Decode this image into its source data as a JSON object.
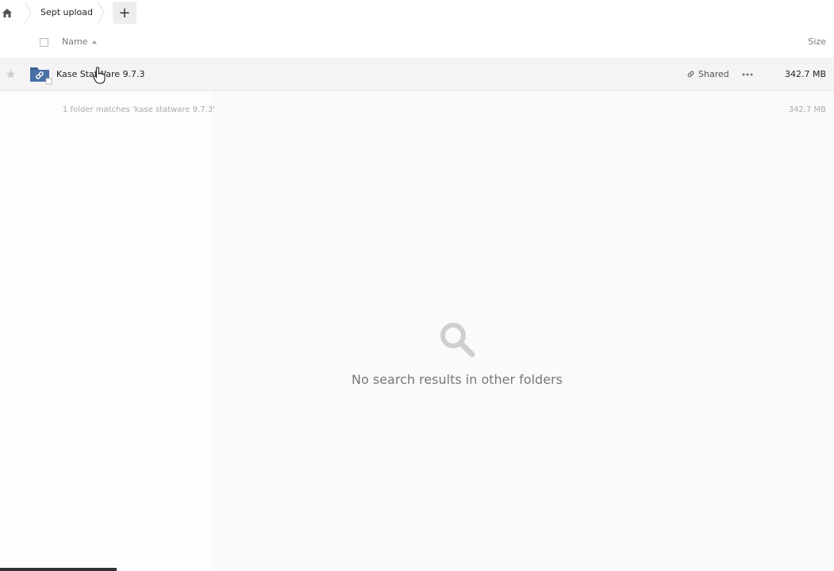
{
  "breadcrumb": {
    "current": "Sept upload",
    "add_label": "+"
  },
  "header": {
    "name_label": "Name",
    "size_label": "Size"
  },
  "files": [
    {
      "name": "Kase StatWare 9.7.3",
      "shared_label": "Shared",
      "size": "342.7 MB"
    }
  ],
  "summary": {
    "text": "1 folder matches 'kase statware 9.7.3'",
    "size": "342.7 MB"
  },
  "empty_state": {
    "message": "No search results in other folders"
  },
  "progress": {
    "fraction": 0.14
  },
  "colors": {
    "folder": "#4a6fa5",
    "row_highlight": "#f4f4f4",
    "muted_text": "#aaaaaa"
  },
  "icons": {
    "home": "home-icon",
    "star": "star-icon",
    "folder": "shared-folder-icon",
    "link": "link-icon",
    "more": "more-icon",
    "search": "search-icon"
  }
}
